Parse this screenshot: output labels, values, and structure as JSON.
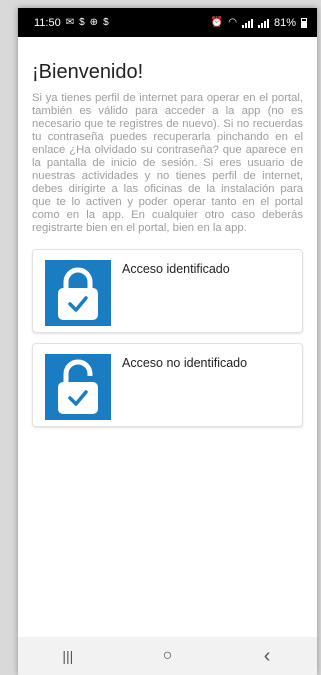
{
  "status": {
    "time": "11:50",
    "battery": "81%",
    "left_icons": [
      "message-icon",
      "alert-icon",
      "sync-icon",
      "alert-icon"
    ],
    "right_icons": [
      "alarm-icon",
      "wifi-icon",
      "signal-icon",
      "signal-icon",
      "battery-icon"
    ]
  },
  "page": {
    "title": "¡Bienvenido!",
    "intro": "Si ya tienes perfil de internet para operar en el portal, también es válido para acceder a la app (no es necesario que te registres de nuevo). Si no recuerdas tu contraseña puedes recuperarla pinchando en el enlace ¿Ha olvidado su contraseña? que aparece en la pantalla de inicio de sesión. Si eres usuario de nuestras actividades y no tienes perfil de internet, debes dirigirte a las oficinas de la instalación para que te lo activen y poder operar tanto en el portal como en la app. En cualquier otro caso deberás registrarte bien en el portal, bien en la app."
  },
  "cards": [
    {
      "label": "Acceso identificado",
      "icon": "locked-padlock-icon"
    },
    {
      "label": "Acceso no identificado",
      "icon": "unlocked-padlock-icon"
    }
  ],
  "nav": {
    "recents_glyph": "|||",
    "home_glyph": "○",
    "back_glyph": "‹"
  },
  "colors": {
    "accent": "#1a7cc1",
    "status_bar": "#000000",
    "intro_text": "#9e9e9e"
  }
}
